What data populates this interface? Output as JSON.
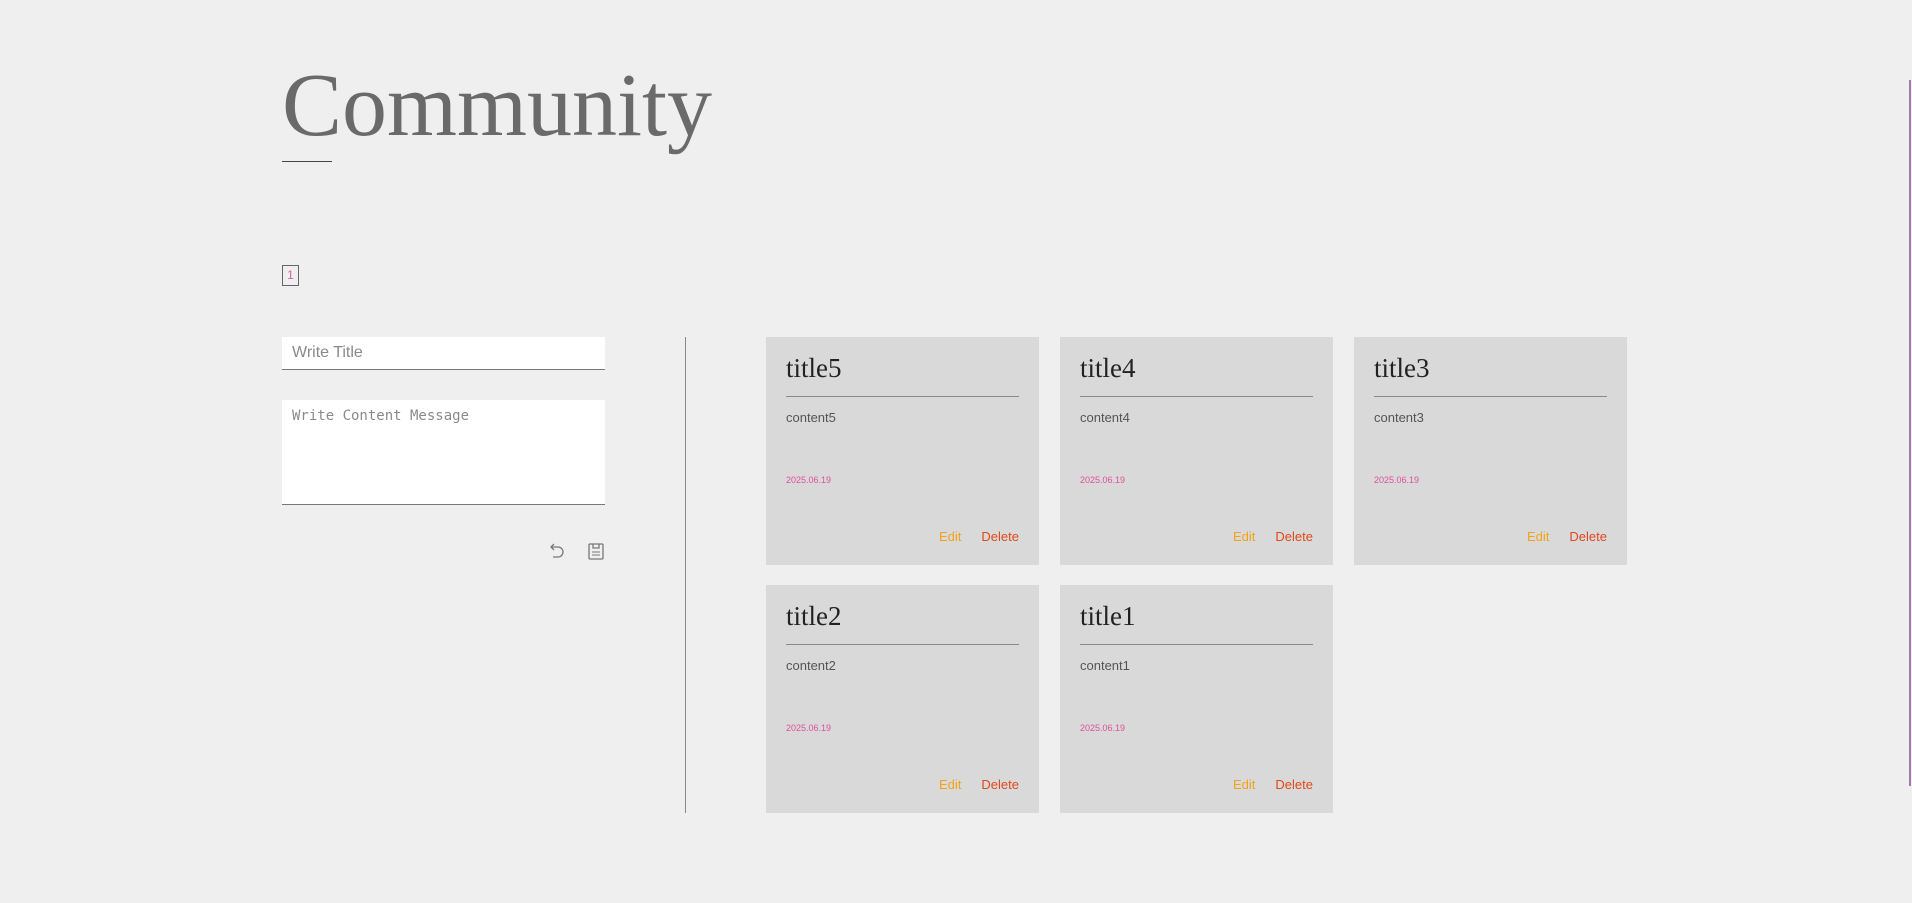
{
  "header": {
    "title": "Community"
  },
  "pagination": {
    "pages": [
      "1"
    ],
    "current": "1"
  },
  "form": {
    "title_placeholder": "Write Title",
    "content_placeholder": "Write Content Message",
    "title_value": "",
    "content_value": "",
    "reset_icon": "undo-icon",
    "submit_icon": "clipboard-icon"
  },
  "posts": [
    {
      "title": "title5",
      "content": "content5",
      "date": "2025.06.19",
      "edit_label": "Edit",
      "delete_label": "Delete"
    },
    {
      "title": "title4",
      "content": "content4",
      "date": "2025.06.19",
      "edit_label": "Edit",
      "delete_label": "Delete"
    },
    {
      "title": "title3",
      "content": "content3",
      "date": "2025.06.19",
      "edit_label": "Edit",
      "delete_label": "Delete"
    },
    {
      "title": "title2",
      "content": "content2",
      "date": "2025.06.19",
      "edit_label": "Edit",
      "delete_label": "Delete"
    },
    {
      "title": "title1",
      "content": "content1",
      "date": "2025.06.19",
      "edit_label": "Edit",
      "delete_label": "Delete"
    }
  ],
  "colors": {
    "background": "#efefef",
    "card": "#d9d9d9",
    "date": "#e0509a",
    "edit": "#f2a21a",
    "delete": "#e0481a",
    "page_number": "#e05a9a"
  }
}
